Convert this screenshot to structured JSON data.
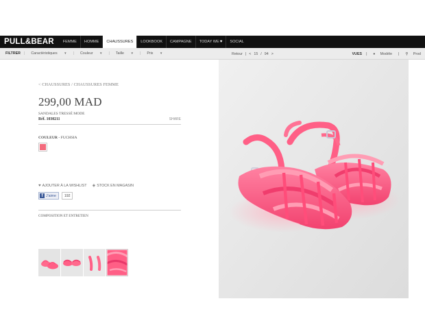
{
  "brand": "PULL&BEAR",
  "nav": {
    "items": [
      {
        "label": "FEMME",
        "active": false
      },
      {
        "label": "HOMME",
        "active": false
      },
      {
        "label": "CHAUSSURES",
        "active": true
      },
      {
        "label": "LOOKBOOK",
        "active": false
      },
      {
        "label": "CAMPAGNE",
        "active": false
      },
      {
        "label": "TODAY WE",
        "active": false,
        "icon": "heart-icon"
      },
      {
        "label": "SOCIAL",
        "active": false
      }
    ]
  },
  "filters": {
    "filter_label": "FILTRER",
    "caracteristiques": "Caractéristiques",
    "couleur": "Couleur",
    "taille": "Taille",
    "prix": "Prix",
    "retour": "Retour",
    "prev": "<",
    "page_current": "15",
    "page_total": "94",
    "next": ">",
    "page_sep": "/",
    "vues": "VUES",
    "modele": "Modèle",
    "produit": "Prod"
  },
  "product": {
    "breadcrumb": "< CHAUSSURES / CHAUSSURES FEMME",
    "price": "299,00 MAD",
    "name": "SANDALES TRESSÉ MODE",
    "ref": "Réf. 1030211",
    "share_label": "SHARE",
    "color_label": "COULEUR",
    "color_sep": " - ",
    "color_name": "FUCHSIA",
    "color_hex": "#f36b7d",
    "wishlist_label": "AJOUTER À LA WISHLIST",
    "stock_label": "STOCK EN MAGASIN",
    "fb_like_label": "J'aime",
    "fb_count": "192",
    "composition_label": "COMPOSITION ET ENTRETIEN"
  },
  "colors": {
    "sandal": "#ff5f86",
    "sandal_dark": "#f03d6d",
    "sandal_light": "#ff9db4",
    "background": "#e6e6e6"
  }
}
